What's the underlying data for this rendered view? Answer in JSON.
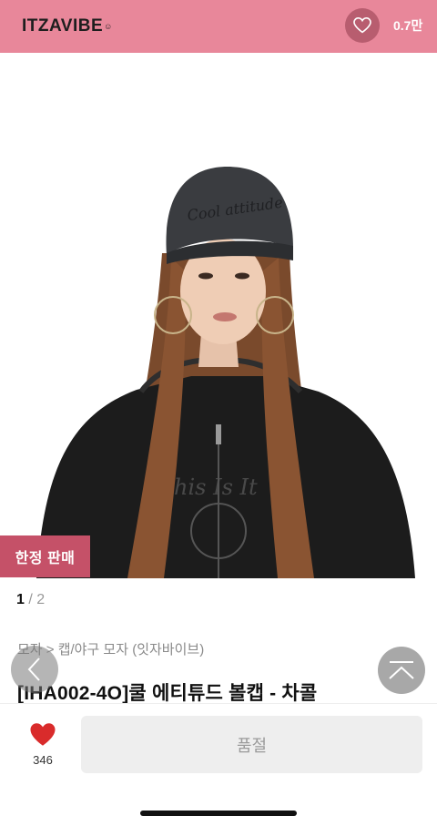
{
  "header": {
    "brand": "ITZAVIBE",
    "brand_mark": "☺",
    "wish_count": "0.7만"
  },
  "product": {
    "badge": "한정 판매",
    "pager": {
      "current": "1",
      "separator": "/",
      "total": "2"
    },
    "breadcrumb": "모자 > 캡/야구 모자 (잇자바이브)",
    "title": "[IHA002-4O]쿨 에티튜드 볼캡 - 차콜"
  },
  "bottom_bar": {
    "like_count": "346",
    "soldout_label": "품절"
  },
  "colors": {
    "header_bg": "#e8879a",
    "badge_bg": "#c55168",
    "like_heart": "#d92b2b"
  },
  "icons": {
    "wish": "heart-outline-icon",
    "prev": "chevron-left-icon",
    "top": "chevron-up-icon",
    "like": "heart-filled-icon"
  }
}
